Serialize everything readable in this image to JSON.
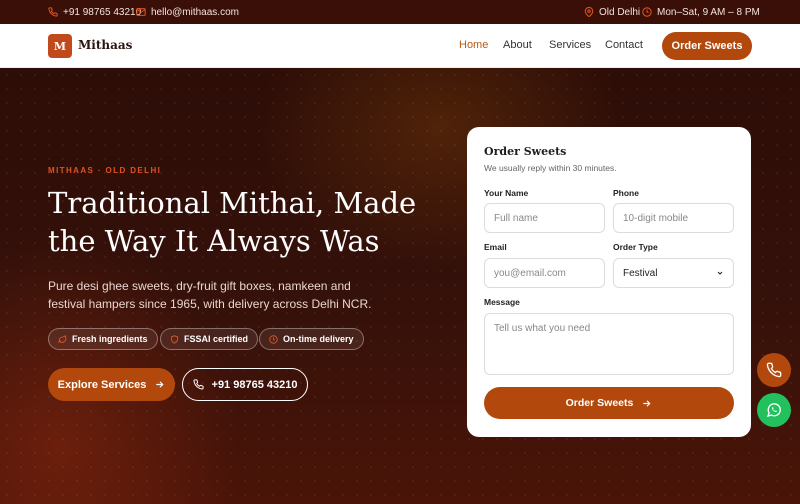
{
  "topbar": {
    "phone": "+91 98765 43210",
    "email": "hello@mithaas.com",
    "location": "Old Delhi",
    "hours": "Mon–Sat, 9 AM – 8 PM"
  },
  "brand": {
    "initial": "M",
    "name": "Mithaas"
  },
  "nav": {
    "links": [
      "Home",
      "About",
      "Services",
      "Contact"
    ],
    "active": "Home",
    "cta": "Order Sweets"
  },
  "hero": {
    "eyebrow": "MITHAAS · OLD DELHI",
    "headline": "Traditional Mithai, Made the Way It Always Was",
    "subtitle": "Pure desi ghee sweets, dry-fruit gift boxes, namkeen and festival hampers since 1965, with delivery across Delhi NCR.",
    "badges": [
      "Fresh ingredients",
      "FSSAI certified",
      "On-time delivery"
    ],
    "primary_button": "Explore Services",
    "secondary_button": "+91 98765 43210"
  },
  "form": {
    "title": "Order Sweets",
    "subtitle": "We usually reply within 30 minutes.",
    "name_label": "Your Name",
    "name_placeholder": "Full name",
    "phone_label": "Phone",
    "phone_placeholder": "10-digit mobile",
    "email_label": "Email",
    "email_placeholder": "you@email.com",
    "order_type_label": "Order Type",
    "order_type_value": "Festival",
    "message_label": "Message",
    "message_placeholder": "Tell us what you need",
    "submit": "Order Sweets"
  },
  "colors": {
    "accent": "#b3480c",
    "eyebrow": "#e0531f",
    "whatsapp": "#22c15e"
  },
  "icons": {
    "phone": "phone-icon",
    "email": "mail-icon",
    "location": "map-pin-icon",
    "hours": "clock-icon",
    "arrow": "arrow-right-icon",
    "whatsapp": "whatsapp-icon"
  }
}
